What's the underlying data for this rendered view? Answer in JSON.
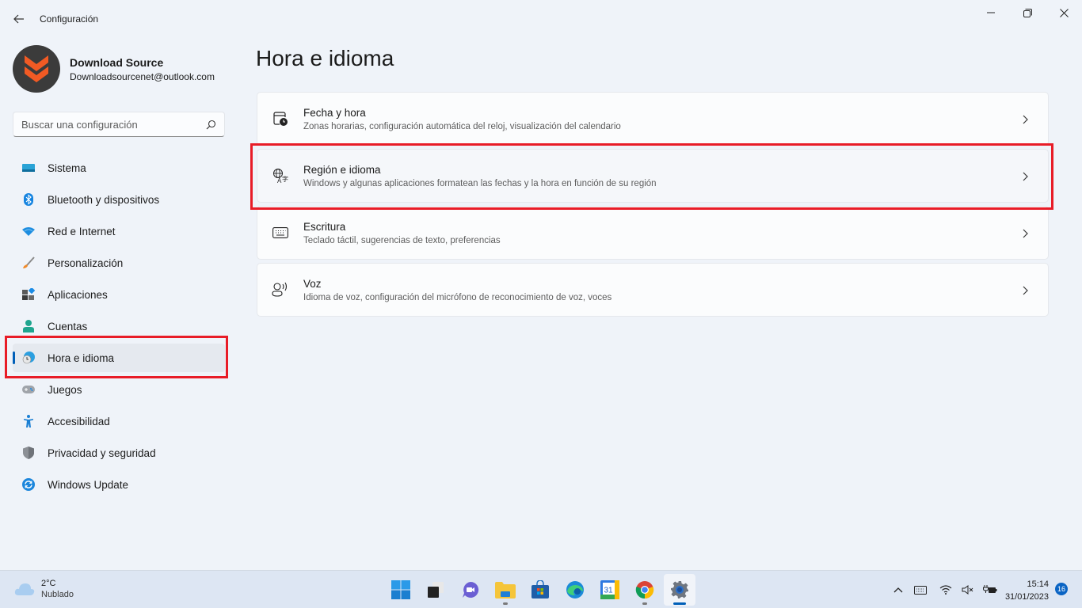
{
  "window": {
    "title": "Configuración",
    "back_icon": "arrow-left-icon",
    "controls": {
      "minimize": "—",
      "maximize": "❐",
      "close": "✕"
    }
  },
  "profile": {
    "name": "Download Source",
    "email": "Downloadsourcenet@outlook.com",
    "avatar_colors": {
      "bg": "#3b3b3b",
      "accent": "#f15a24"
    }
  },
  "search": {
    "placeholder": "Buscar una configuración",
    "value": ""
  },
  "sidebar": {
    "items": [
      {
        "label": "Sistema",
        "icon": "system-icon",
        "active": false
      },
      {
        "label": "Bluetooth y dispositivos",
        "icon": "bluetooth-icon",
        "active": false
      },
      {
        "label": "Red e Internet",
        "icon": "wifi-icon",
        "active": false
      },
      {
        "label": "Personalización",
        "icon": "brush-icon",
        "active": false
      },
      {
        "label": "Aplicaciones",
        "icon": "apps-icon",
        "active": false
      },
      {
        "label": "Cuentas",
        "icon": "accounts-icon",
        "active": false
      },
      {
        "label": "Hora e idioma",
        "icon": "time-language-icon",
        "active": true
      },
      {
        "label": "Juegos",
        "icon": "gamepad-icon",
        "active": false
      },
      {
        "label": "Accesibilidad",
        "icon": "accessibility-icon",
        "active": false
      },
      {
        "label": "Privacidad y seguridad",
        "icon": "shield-icon",
        "active": false
      },
      {
        "label": "Windows Update",
        "icon": "update-icon",
        "active": false
      }
    ]
  },
  "main": {
    "title": "Hora e idioma",
    "cards": [
      {
        "title": "Fecha y hora",
        "subtitle": "Zonas horarias, configuración automática del reloj, visualización del calendario",
        "icon": "calendar-clock-icon"
      },
      {
        "title": "Región e idioma",
        "subtitle": "Windows y algunas aplicaciones formatean las fechas y la hora en función de su región",
        "icon": "language-icon"
      },
      {
        "title": "Escritura",
        "subtitle": "Teclado táctil, sugerencias de texto, preferencias",
        "icon": "keyboard-icon"
      },
      {
        "title": "Voz",
        "subtitle": "Idioma de voz, configuración del micrófono de reconocimiento de voz, voces",
        "icon": "speech-icon"
      }
    ]
  },
  "annotations": {
    "highlight_color": "#e81c27"
  },
  "taskbar": {
    "weather": {
      "temp": "2°C",
      "desc": "Nublado"
    },
    "apps": [
      {
        "name": "start",
        "running": false
      },
      {
        "name": "task-view",
        "running": false
      },
      {
        "name": "chat",
        "running": false
      },
      {
        "name": "file-explorer",
        "running": true
      },
      {
        "name": "microsoft-store",
        "running": false
      },
      {
        "name": "edge",
        "running": false
      },
      {
        "name": "calendar",
        "running": false,
        "label": "31"
      },
      {
        "name": "chrome",
        "running": true
      },
      {
        "name": "settings",
        "running": true,
        "active": true
      }
    ],
    "tray": {
      "chevron": "^",
      "time": "15:14",
      "date": "31/01/2023",
      "notifications": "16"
    }
  },
  "colors": {
    "accent": "#005fb8",
    "background": "#eff3f9"
  }
}
